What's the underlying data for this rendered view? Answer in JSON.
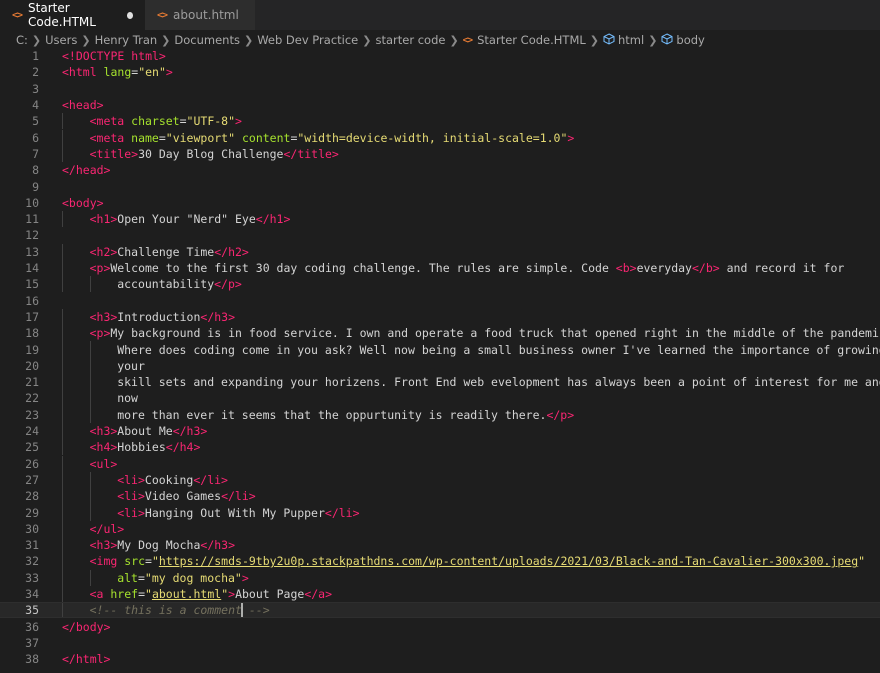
{
  "tabs": [
    {
      "label": "Starter Code.HTML",
      "icon": "html-file-icon",
      "modified": true,
      "active": true
    },
    {
      "label": "about.html",
      "icon": "html-file-icon",
      "modified": false,
      "active": false
    }
  ],
  "breadcrumbs": [
    "C:",
    "Users",
    "Henry Tran",
    "Documents",
    "Web Dev Practice",
    "starter code",
    "Starter Code.HTML",
    "html",
    "body"
  ],
  "editor": {
    "current_line": 35,
    "lines": [
      {
        "n": "1",
        "indent": 0,
        "parts": [
          [
            "tag",
            "<!DOCTYPE html>"
          ]
        ]
      },
      {
        "n": "2",
        "indent": 0,
        "parts": [
          [
            "tag",
            "<html "
          ],
          [
            "attr",
            "lang"
          ],
          [
            "txt",
            "="
          ],
          [
            "str",
            "\"en\""
          ],
          [
            "tag",
            ">"
          ]
        ]
      },
      {
        "n": "3",
        "indent": 0,
        "parts": []
      },
      {
        "n": "4",
        "indent": 0,
        "parts": [
          [
            "tag",
            "<head>"
          ]
        ]
      },
      {
        "n": "5",
        "indent": 1,
        "parts": [
          [
            "tag",
            "<meta "
          ],
          [
            "attr",
            "charset"
          ],
          [
            "txt",
            "="
          ],
          [
            "str",
            "\"UTF-8\""
          ],
          [
            "tag",
            ">"
          ]
        ]
      },
      {
        "n": "6",
        "indent": 1,
        "parts": [
          [
            "tag",
            "<meta "
          ],
          [
            "attr",
            "name"
          ],
          [
            "txt",
            "="
          ],
          [
            "str",
            "\"viewport\""
          ],
          [
            "txt",
            " "
          ],
          [
            "attr",
            "content"
          ],
          [
            "txt",
            "="
          ],
          [
            "str",
            "\"width=device-width, initial-scale=1.0\""
          ],
          [
            "tag",
            ">"
          ]
        ]
      },
      {
        "n": "7",
        "indent": 1,
        "parts": [
          [
            "tag",
            "<title>"
          ],
          [
            "txt",
            "30 Day Blog Challenge"
          ],
          [
            "tag",
            "</title>"
          ]
        ]
      },
      {
        "n": "8",
        "indent": 0,
        "parts": [
          [
            "tag",
            "</head>"
          ]
        ]
      },
      {
        "n": "9",
        "indent": 0,
        "parts": []
      },
      {
        "n": "10",
        "indent": 0,
        "parts": [
          [
            "tag",
            "<body>"
          ]
        ]
      },
      {
        "n": "11",
        "indent": 1,
        "parts": [
          [
            "tag",
            "<h1>"
          ],
          [
            "txt",
            "Open Your \"Nerd\" Eye"
          ],
          [
            "tag",
            "</h1>"
          ]
        ]
      },
      {
        "n": "12",
        "indent": 0,
        "parts": []
      },
      {
        "n": "13",
        "indent": 1,
        "parts": [
          [
            "tag",
            "<h2>"
          ],
          [
            "txt",
            "Challenge Time"
          ],
          [
            "tag",
            "</h2>"
          ]
        ]
      },
      {
        "n": "14",
        "indent": 1,
        "parts": [
          [
            "tag",
            "<p>"
          ],
          [
            "txt",
            "Welcome to the first 30 day coding challenge. The rules are simple. Code "
          ],
          [
            "tag",
            "<b>"
          ],
          [
            "txt",
            "everyday"
          ],
          [
            "tag",
            "</b>"
          ],
          [
            "txt",
            " and record it for"
          ]
        ]
      },
      {
        "n": "15",
        "indent": 2,
        "parts": [
          [
            "txt",
            "accountability"
          ],
          [
            "tag",
            "</p>"
          ]
        ]
      },
      {
        "n": "16",
        "indent": 0,
        "parts": []
      },
      {
        "n": "17",
        "indent": 1,
        "parts": [
          [
            "tag",
            "<h3>"
          ],
          [
            "txt",
            "Introduction"
          ],
          [
            "tag",
            "</h3>"
          ]
        ]
      },
      {
        "n": "18",
        "indent": 1,
        "parts": [
          [
            "tag",
            "<p>"
          ],
          [
            "txt",
            "My background is in food service. I own and operate a food truck that opened right in the middle of the pandemic."
          ]
        ]
      },
      {
        "n": "19",
        "indent": 2,
        "parts": [
          [
            "txt",
            "Where does coding come in you ask? Well now being a small business owner I've learned the importance of growing"
          ]
        ]
      },
      {
        "n": "20",
        "indent": 2,
        "parts": [
          [
            "txt",
            "your"
          ]
        ]
      },
      {
        "n": "21",
        "indent": 2,
        "parts": [
          [
            "txt",
            "skill sets and expanding your horizens. Front End web evelopment has always been a point of interest for me and"
          ]
        ]
      },
      {
        "n": "22",
        "indent": 2,
        "parts": [
          [
            "txt",
            "now"
          ]
        ]
      },
      {
        "n": "23",
        "indent": 2,
        "parts": [
          [
            "txt",
            "more than ever it seems that the oppurtunity is readily there."
          ],
          [
            "tag",
            "</p>"
          ]
        ]
      },
      {
        "n": "24",
        "indent": 1,
        "parts": [
          [
            "tag",
            "<h3>"
          ],
          [
            "txt",
            "About Me"
          ],
          [
            "tag",
            "</h3>"
          ]
        ]
      },
      {
        "n": "25",
        "indent": 1,
        "parts": [
          [
            "tag",
            "<h4>"
          ],
          [
            "txt",
            "Hobbies"
          ],
          [
            "tag",
            "</h4>"
          ]
        ]
      },
      {
        "n": "26",
        "indent": 1,
        "parts": [
          [
            "tag",
            "<ul>"
          ]
        ]
      },
      {
        "n": "27",
        "indent": 2,
        "parts": [
          [
            "tag",
            "<li>"
          ],
          [
            "txt",
            "Cooking"
          ],
          [
            "tag",
            "</li>"
          ]
        ]
      },
      {
        "n": "28",
        "indent": 2,
        "parts": [
          [
            "tag",
            "<li>"
          ],
          [
            "txt",
            "Video Games"
          ],
          [
            "tag",
            "</li>"
          ]
        ]
      },
      {
        "n": "29",
        "indent": 2,
        "parts": [
          [
            "tag",
            "<li>"
          ],
          [
            "txt",
            "Hanging Out With My Pupper"
          ],
          [
            "tag",
            "</li>"
          ]
        ]
      },
      {
        "n": "30",
        "indent": 1,
        "parts": [
          [
            "tag",
            "</ul>"
          ]
        ]
      },
      {
        "n": "31",
        "indent": 1,
        "parts": [
          [
            "tag",
            "<h3>"
          ],
          [
            "txt",
            "My Dog Mocha"
          ],
          [
            "tag",
            "</h3>"
          ]
        ]
      },
      {
        "n": "32",
        "indent": 1,
        "parts": [
          [
            "tag",
            "<img "
          ],
          [
            "attr",
            "src"
          ],
          [
            "txt",
            "="
          ],
          [
            "str",
            "\""
          ],
          [
            "url",
            "https://smds-9tby2u0p.stackpathdns.com/wp-content/uploads/2021/03/Black-and-Tan-Cavalier-300x300.jpeg"
          ],
          [
            "str",
            "\""
          ]
        ]
      },
      {
        "n": "33",
        "indent": 2,
        "parts": [
          [
            "attr",
            "alt"
          ],
          [
            "txt",
            "="
          ],
          [
            "str",
            "\"my dog mocha\""
          ],
          [
            "tag",
            ">"
          ]
        ]
      },
      {
        "n": "34",
        "indent": 1,
        "parts": [
          [
            "tag",
            "<a "
          ],
          [
            "attr",
            "href"
          ],
          [
            "txt",
            "="
          ],
          [
            "str",
            "\""
          ],
          [
            "url",
            "about.html"
          ],
          [
            "str",
            "\""
          ],
          [
            "tag",
            ">"
          ],
          [
            "txt",
            "About Page"
          ],
          [
            "tag",
            "</a>"
          ]
        ]
      },
      {
        "n": "35",
        "indent": 1,
        "parts": [
          [
            "cmt",
            "<!-- this is a comment"
          ],
          [
            "cursor",
            ""
          ],
          [
            "cmt",
            " -->"
          ]
        ]
      },
      {
        "n": "36",
        "indent": 0,
        "parts": [
          [
            "tag",
            "</body>"
          ]
        ]
      },
      {
        "n": "37",
        "indent": 0,
        "parts": []
      },
      {
        "n": "38",
        "indent": 0,
        "parts": [
          [
            "tag",
            "</html>"
          ]
        ]
      }
    ]
  }
}
